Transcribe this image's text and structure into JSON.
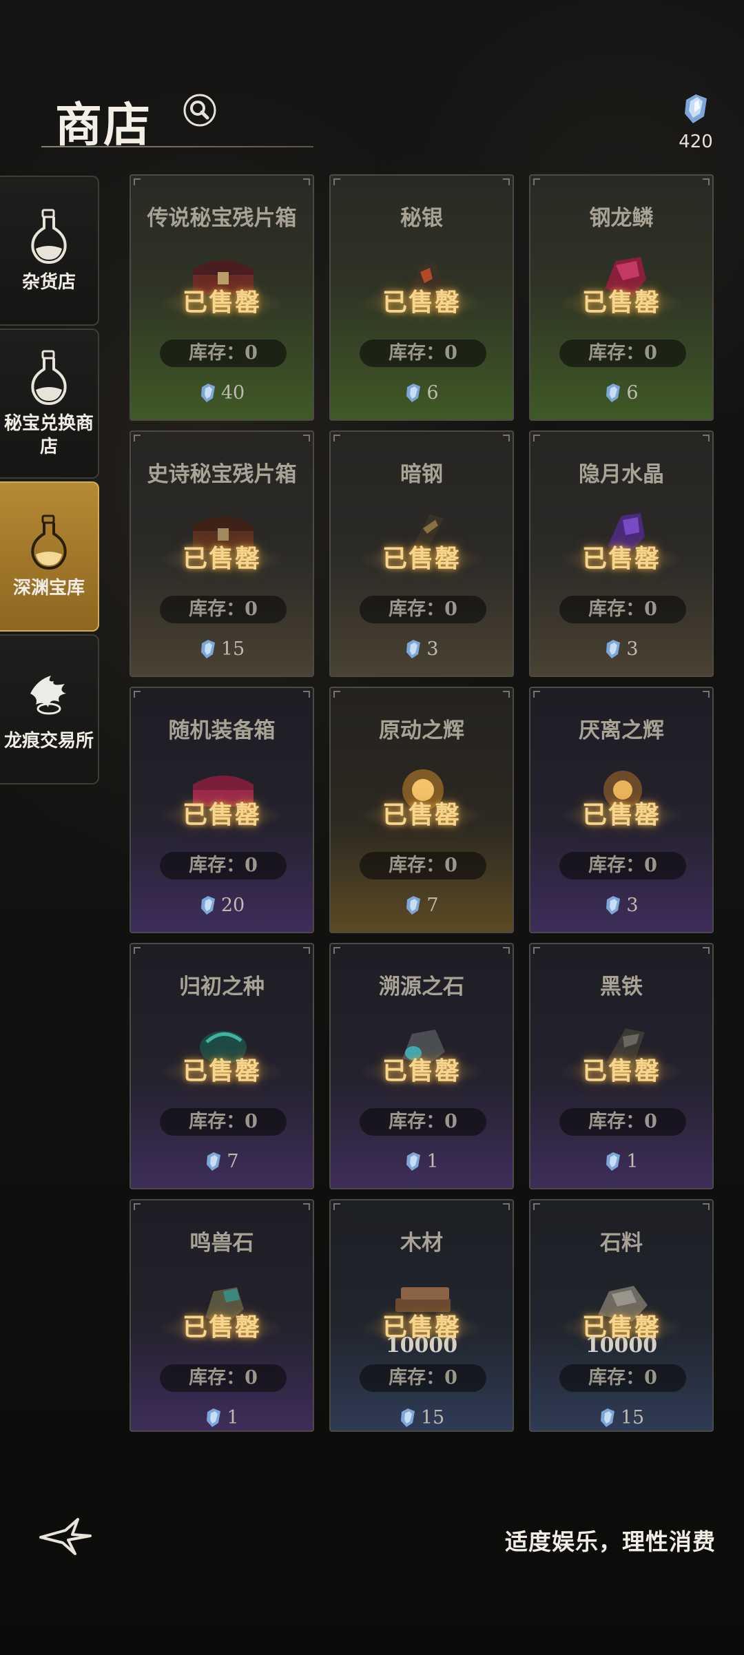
{
  "header": {
    "title": "商店",
    "currency_amount": "420"
  },
  "sidebar": {
    "items": [
      {
        "label": "杂货店",
        "icon": "potion-icon",
        "active": false
      },
      {
        "label": "秘宝兑换商店",
        "icon": "potion-icon",
        "active": false
      },
      {
        "label": "深渊宝库",
        "icon": "potion-icon",
        "active": true
      },
      {
        "label": "龙痕交易所",
        "icon": "dragon-mark-icon",
        "active": false
      }
    ]
  },
  "shop": {
    "sold_label": "已售罄",
    "stock_label": "库存：0",
    "items": [
      {
        "name": "传说秘宝残片箱",
        "price": "40",
        "rarity": "green"
      },
      {
        "name": "秘银",
        "price": "6",
        "rarity": "green"
      },
      {
        "name": "钢龙鳞",
        "price": "6",
        "rarity": "green"
      },
      {
        "name": "史诗秘宝残片箱",
        "price": "15",
        "rarity": "brown"
      },
      {
        "name": "暗钢",
        "price": "3",
        "rarity": "brown"
      },
      {
        "name": "隐月水晶",
        "price": "3",
        "rarity": "brown"
      },
      {
        "name": "随机装备箱",
        "price": "20",
        "rarity": "purple"
      },
      {
        "name": "原动之辉",
        "price": "7",
        "rarity": "gold"
      },
      {
        "name": "厌离之辉",
        "price": "3",
        "rarity": "purple"
      },
      {
        "name": "归初之种",
        "price": "7",
        "rarity": "purple"
      },
      {
        "name": "溯源之石",
        "price": "1",
        "rarity": "purple"
      },
      {
        "name": "黑铁",
        "price": "1",
        "rarity": "purple"
      },
      {
        "name": "鸣兽石",
        "price": "1",
        "rarity": "purple"
      },
      {
        "name": "木材",
        "price": "15",
        "rarity": "blue",
        "quantity": "10000"
      },
      {
        "name": "石料",
        "price": "15",
        "rarity": "blue",
        "quantity": "10000"
      }
    ]
  },
  "footer": {
    "notice": "适度娱乐，理性消费"
  },
  "colors": {
    "accent_gold": "#b58a35",
    "sold_text": "#f6d58e"
  }
}
